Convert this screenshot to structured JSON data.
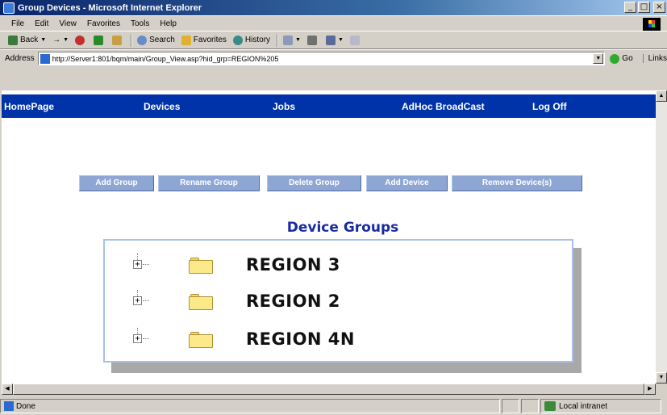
{
  "window": {
    "title": "Group Devices - Microsoft Internet Explorer",
    "buttons": [
      "_",
      "□",
      "×"
    ]
  },
  "menu": [
    "File",
    "Edit",
    "View",
    "Favorites",
    "Tools",
    "Help"
  ],
  "toolbar": {
    "back": "Back",
    "search": "Search",
    "favorites": "Favorites",
    "history": "History"
  },
  "address": {
    "label": "Address",
    "url": "http://Server1:801/bqm/main/Group_View.asp?hid_grp=REGION%205",
    "go": "Go",
    "links": "Links"
  },
  "nav": {
    "items": [
      "HomePage",
      "Devices",
      "Jobs",
      "AdHoc BroadCast",
      "Log Off"
    ]
  },
  "actions": [
    "Add Group",
    "Rename Group",
    "Delete Group",
    "Add Device",
    "Remove Device(s)"
  ],
  "groups": {
    "title": "Device Groups",
    "items": [
      {
        "expander": "+",
        "label": "REGION 3",
        "icon": "folder-icon"
      },
      {
        "expander": "+",
        "label": "REGION 2",
        "icon": "folder-icon"
      },
      {
        "expander": "+",
        "label": "REGION 4N",
        "icon": "folder-icon"
      }
    ]
  },
  "status": {
    "text": "Done",
    "zone": "Local intranet"
  },
  "colors": {
    "nav_bg": "#0033aa",
    "button_bg": "#8ea6d4",
    "title_color": "#1a2aa0",
    "box_border": "#a8c0e8"
  }
}
